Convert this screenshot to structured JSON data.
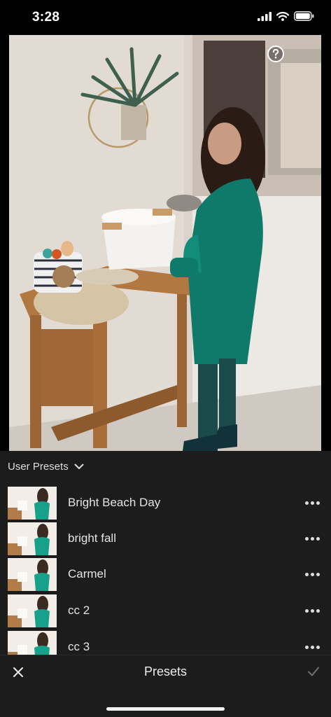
{
  "status_bar": {
    "time": "3:28"
  },
  "photo": {
    "help_icon": "question-circle-icon"
  },
  "presets": {
    "group_label": "User Presets",
    "items": [
      {
        "name": "Bright Beach Day"
      },
      {
        "name": "bright fall"
      },
      {
        "name": "Carmel"
      },
      {
        "name": "cc 2"
      },
      {
        "name": "cc 3"
      }
    ]
  },
  "bottom_bar": {
    "title": "Presets",
    "cancel_icon": "close-icon",
    "confirm_icon": "checkmark-icon"
  },
  "colors": {
    "panel_bg": "#1c1c1c",
    "status_bg": "#000000",
    "velvet_teal": "#0f7a6a"
  }
}
